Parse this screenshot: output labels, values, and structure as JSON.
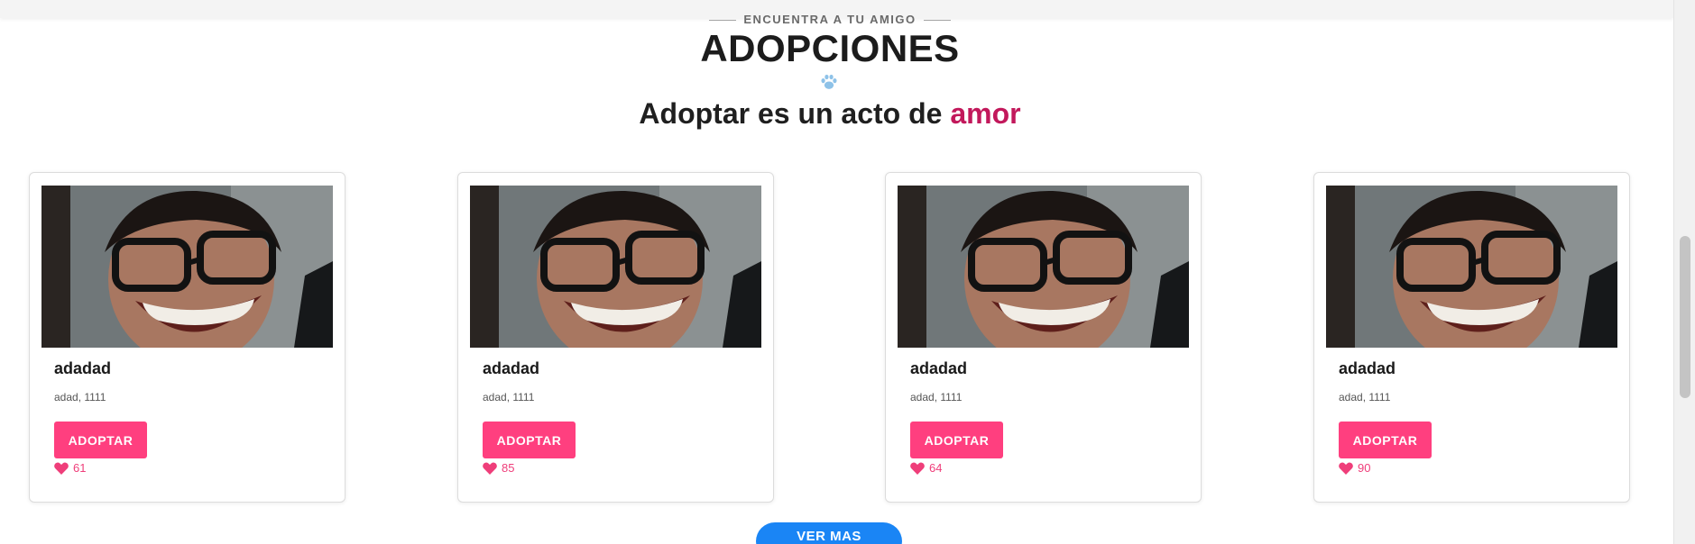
{
  "section": {
    "eyebrow": "ENCUENTRA A TU AMIGO",
    "title": "ADOPCIONES",
    "subtitle_prefix": "Adoptar es un acto de ",
    "subtitle_accent": "amor",
    "icon": "paw-icon"
  },
  "colors": {
    "adopt_button": "#ff3f7f",
    "accent_text": "#c2185b",
    "likes": "#ef3e7a",
    "more_button": "#1a85f5",
    "paw": "#8ec2e8"
  },
  "cards": [
    {
      "name": "adadad",
      "details": "adad, 1111",
      "button": "ADOPTAR",
      "likes": "61",
      "photo": "person-photo",
      "like_icon": "heart-icon"
    },
    {
      "name": "adadad",
      "details": "adad, 1111",
      "button": "ADOPTAR",
      "likes": "85",
      "photo": "person-photo",
      "like_icon": "heart-icon"
    },
    {
      "name": "adadad",
      "details": "adad, 1111",
      "button": "ADOPTAR",
      "likes": "64",
      "photo": "person-photo",
      "like_icon": "heart-icon"
    },
    {
      "name": "adadad",
      "details": "adad, 1111",
      "button": "ADOPTAR",
      "likes": "90",
      "photo": "person-photo",
      "like_icon": "heart-icon"
    }
  ],
  "more_button": "VER MAS"
}
